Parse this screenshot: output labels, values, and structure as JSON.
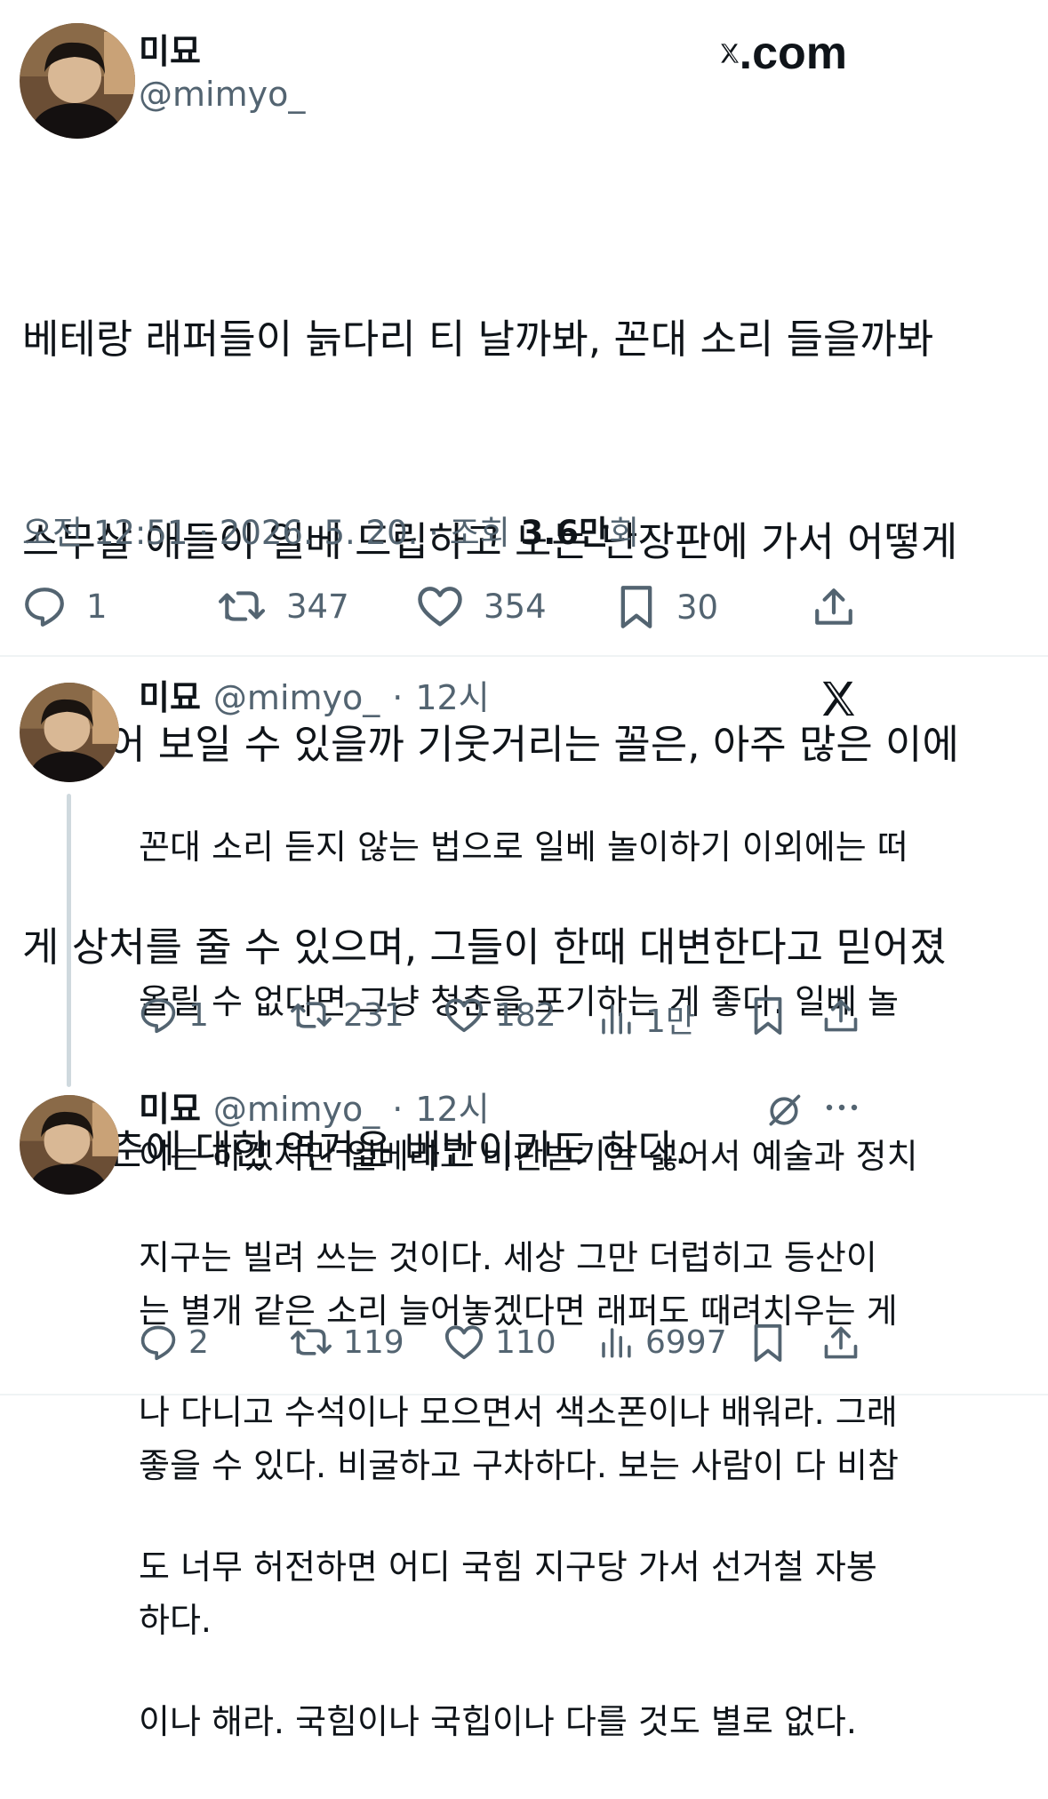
{
  "site": {
    "brand": "X.com"
  },
  "main_tweet": {
    "author": {
      "name": "미묘",
      "handle": "@mimyo_"
    },
    "text_lines": [
      "베테랑 래퍼들이 늙다리 티 날까봐, 꼰대 소리 들을까봐",
      "스무살 애들이 일베 드립하고 노는 난장판에 가서 어떻게",
      "좀 젊어 보일 수 있을까 기웃거리는 꼴은, 아주 많은 이에",
      "게 상처를 줄 수 있으며, 그들이 한때 대변한다고 믿어졌",
      "던 청춘에 대한 역겨운 배반이기도 하다."
    ],
    "meta": {
      "time": "오전 12:51",
      "date": "2026. 5. 20.",
      "views_label": "조회",
      "views_count": "3.6만",
      "views_suffix": "회",
      "sep": "·"
    },
    "actions": {
      "replies": "1",
      "retweets": "347",
      "likes": "354",
      "bookmarks": "30"
    }
  },
  "replies": [
    {
      "author": {
        "name": "미묘",
        "handle": "@mimyo_",
        "sep": "·",
        "time": "12시"
      },
      "text_lines": [
        "꼰대 소리 듣지 않는 법으로 일베 놀이하기 이외에는 떠",
        "올릴 수 없다면 그냥 청춘을 포기하는 게 좋다. 일베 놀",
        "이는 하겠지만 일베라고 비판받기는 싫어서 예술과 정치",
        "는 별개 같은 소리 늘어놓겠다면 래퍼도 때려치우는 게",
        "좋을 수 있다. 비굴하고 구차하다. 보는 사람이 다 비참",
        "하다."
      ],
      "actions": {
        "replies": "1",
        "retweets": "231",
        "likes": "182",
        "views": "1만"
      }
    },
    {
      "author": {
        "name": "미묘",
        "handle": "@mimyo_",
        "sep": "·",
        "time": "12시"
      },
      "text_lines": [
        "지구는 빌려 쓰는 것이다. 세상 그만 더럽히고 등산이",
        "나 다니고 수석이나 모으면서 색소폰이나 배워라. 그래",
        "도 너무 허전하면 어디 국힘 지구당 가서 선거철 자봉",
        "이나 해라. 국힘이나 국힙이나 다를 것도 별로 없다."
      ],
      "actions": {
        "replies": "2",
        "retweets": "119",
        "likes": "110",
        "views": "6997"
      }
    }
  ],
  "icons": {
    "reply": "reply-icon",
    "retweet": "retweet-icon",
    "like": "heart-icon",
    "bookmark": "bookmark-icon",
    "share": "share-icon",
    "views": "views-icon",
    "x_logo": "x-logo-icon",
    "grok": "grok-icon",
    "more": "more-icon"
  },
  "colors": {
    "text": "#0f1419",
    "secondary": "#536471",
    "divider": "#eff3f4",
    "thread_line": "#cfd9de"
  }
}
